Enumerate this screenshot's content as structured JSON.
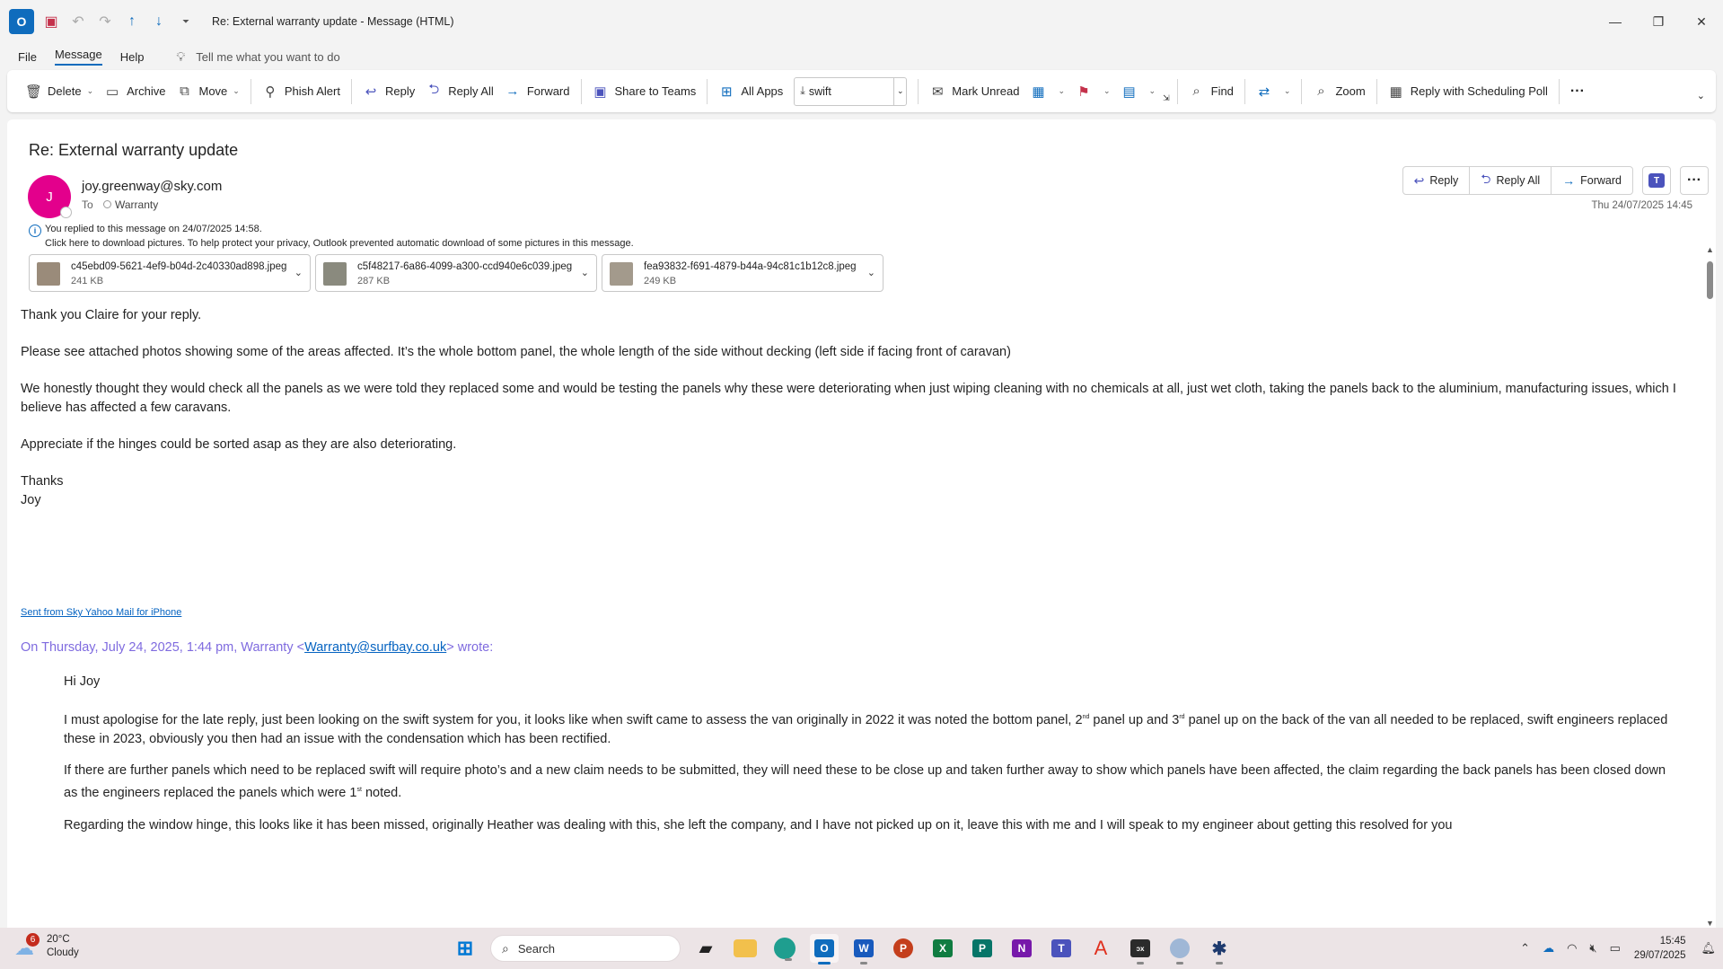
{
  "window": {
    "title": "Re: External warranty update  -  Message (HTML)",
    "app_icon": "O",
    "minimize": "—",
    "restore": "❐",
    "close": "✕"
  },
  "menu": {
    "tabs": [
      "File",
      "Message",
      "Help"
    ],
    "active_tab": "Message",
    "tell_me": "Tell me what you want to do"
  },
  "ribbon": {
    "delete": "Delete",
    "archive": "Archive",
    "move": "Move",
    "phish_alert": "Phish Alert",
    "reply": "Reply",
    "reply_all": "Reply All",
    "forward": "Forward",
    "share_to_teams": "Share to Teams",
    "all_apps": "All Apps",
    "quick_step": "swift",
    "mark_unread": "Mark Unread",
    "find": "Find",
    "zoom": "Zoom",
    "reply_scheduling_poll": "Reply with Scheduling Poll",
    "more": "···"
  },
  "message": {
    "subject": "Re: External warranty update",
    "avatar_initial": "J",
    "avatar_color": "#e3008c",
    "sender": "joy.greenway@sky.com",
    "to_label": "To",
    "to_recipient": "Warranty",
    "date": "Thu 24/07/2025 14:45",
    "actions": {
      "reply": "Reply",
      "reply_all": "Reply All",
      "forward": "Forward"
    },
    "teams_icon_label": "T",
    "info_line1": "You replied to this message on 24/07/2025 14:58.",
    "info_line2": "Click here to download pictures. To help protect your privacy, Outlook prevented automatic download of some pictures in this message.",
    "attachments": [
      {
        "name": "c45ebd09-5621-4ef9-b04d-2c40330ad898.jpeg",
        "size": "241 KB"
      },
      {
        "name": "c5f48217-6a86-4099-a300-ccd940e6c039.jpeg",
        "size": "287 KB"
      },
      {
        "name": "fea93832-f691-4879-b44a-94c81c1b12c8.jpeg",
        "size": "249 KB"
      }
    ],
    "body": {
      "p1": "Thank you Claire for your reply.",
      "p2": "Please see attached photos showing some of the areas affected. It’s the whole bottom panel, the whole length of the side without decking (left side if facing front of caravan)",
      "p3": "We honestly thought they would check all the panels as we were told they replaced some and would be testing the panels why these were deteriorating when just wiping cleaning with no chemicals at all, just wet cloth, taking the panels back to the aluminium, manufacturing issues, which I believe has affected a few caravans.",
      "p4": "Appreciate if the hinges could be sorted asap as they are also deteriorating.",
      "p5a": "Thanks",
      "p5b": "Joy",
      "signature": "Sent from Sky Yahoo Mail for iPhone",
      "quote_prefix": "On Thursday, July 24, 2025, 1:44 pm, Warranty <",
      "quote_email": "Warranty@surfbay.co.uk",
      "quote_suffix": "> wrote:",
      "q1": "Hi Joy",
      "q2a": "I must apologise for the late reply, just been looking on the swift system for you, it looks like when swift came to assess the van originally in 2022 it was noted the bottom panel, 2",
      "q2_sup1": "nd",
      "q2b": " panel up and 3",
      "q2_sup2": "rd",
      "q2c": " panel up on the back of the van all needed to be replaced, swift engineers replaced these in 2023, obviously you then had an issue with the condensation which has been rectified.",
      "q3a": "If there are further panels which need to be replaced swift will require photo’s and a new claim needs to be submitted,  they will need these to be close up and taken further away to show which panels have been affected, the claim regarding the back panels has been closed down as the engineers replaced the panels which were 1",
      "q3_sup": "st",
      "q3b": " noted.",
      "q4": "Regarding the window hinge, this looks like it has been missed, originally Heather was dealing with this, she left the company, and I have not picked up on it, leave this with me and I will speak to my engineer about getting this resolved for you"
    }
  },
  "taskbar": {
    "weather_badge": "6",
    "temperature": "20°C",
    "condition": "Cloudy",
    "search_label": "Search",
    "time": "15:45",
    "date": "29/07/2025"
  },
  "colors": {
    "accent": "#0f6cbd",
    "avatar": "#e3008c",
    "quote_header": "#7f6bdf"
  }
}
